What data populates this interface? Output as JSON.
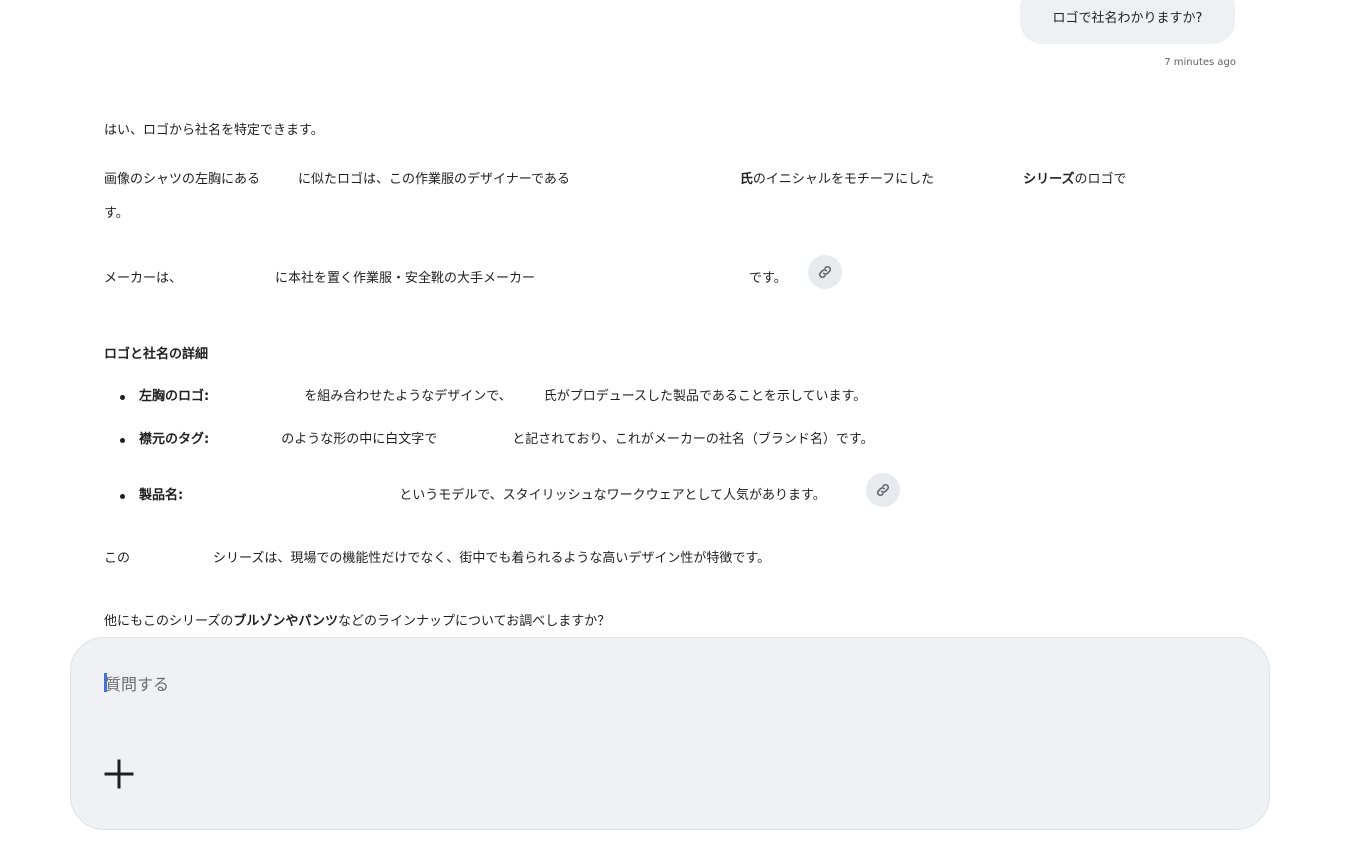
{
  "conversation": {
    "user_message": "ロゴで社名わかりますか?",
    "timestamp": "7 minutes ago"
  },
  "response": {
    "intro": "はい、ロゴから社名を特定できます。",
    "para1_a": "画像のシャツの左胸にある",
    "para1_b": "に似たロゴは、この作業服のデザイナーである",
    "para1_c_bold": "氏",
    "para1_d": "のイニシャルをモチーフにした",
    "para1_e_bold": "シリーズ",
    "para1_f": "のロゴで",
    "para1_g": "す。",
    "maker_a": "メーカーは、",
    "maker_b": "に本社を置く作業服・安全靴の大手メーカー",
    "maker_c": "です。",
    "details_heading": "ロゴと社名の詳細",
    "bullet1_label": "左胸のロゴ:",
    "bullet1_a": "を組み合わせたようなデザインで、",
    "bullet1_b": "氏がプロデュースした製品であることを示しています。",
    "bullet2_label": "襟元のタグ:",
    "bullet2_a": "のような形の中に白文字で",
    "bullet2_b": "と記されており、これがメーカーの社名（ブランド名）です。",
    "bullet3_label": "製品名:",
    "bullet3_a": "というモデルで、スタイリッシュなワークウェアとして人気があります。",
    "series_a": "この",
    "series_b": "シリーズは、現場での機能性だけでなく、街中でも着られるような高いデザイン性が特徴です。",
    "question_a": "他にもこのシリーズの",
    "question_b_bold": "ブルゾンやパンツ",
    "question_c": "などのラインナップについてお調べしますか？"
  },
  "input": {
    "placeholder": "質問する"
  },
  "icons": {
    "source_link": "link-icon",
    "add": "plus-icon"
  },
  "colors": {
    "bubble": "#eef0f4",
    "input_bg": "#eff1f5",
    "chip": "#e8eaed",
    "caret": "#4b6fd8"
  }
}
